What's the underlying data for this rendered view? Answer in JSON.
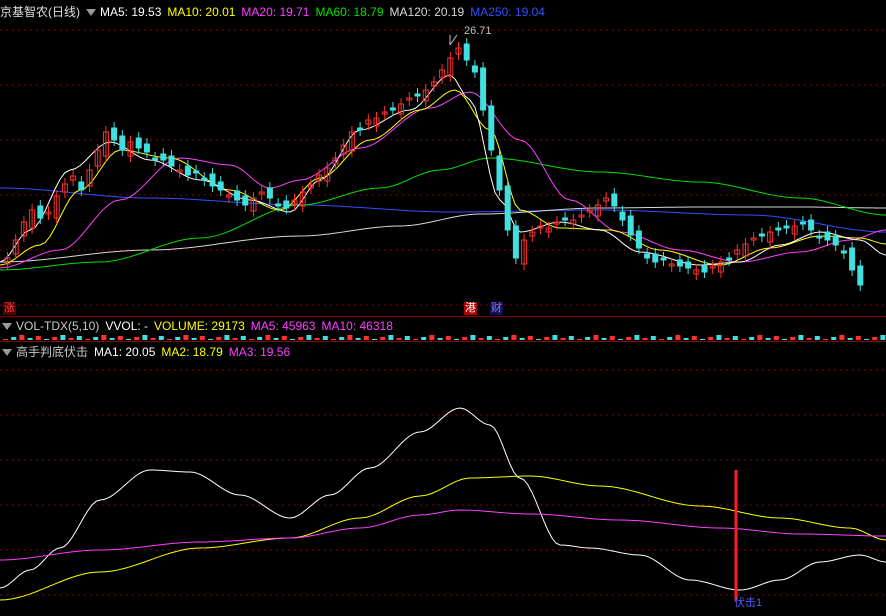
{
  "main": {
    "title": "京基智农(日线)",
    "ma": [
      {
        "label": "MA5: 19.53",
        "color": "#ffffff"
      },
      {
        "label": "MA10: 20.01",
        "color": "#ffff00"
      },
      {
        "label": "MA20: 19.71",
        "color": "#ff40ff"
      },
      {
        "label": "MA60: 18.79",
        "color": "#00e000"
      },
      {
        "label": "MA120: 20.19",
        "color": "#d8d8d8"
      },
      {
        "label": "MA250: 19.04",
        "color": "#3050ff"
      }
    ],
    "peak_label": "26.71",
    "tags": [
      {
        "text": "涨",
        "color": "#ff4040",
        "bg": "#500000"
      },
      {
        "text": "港",
        "color": "#ffffff",
        "bg": "#b00000"
      },
      {
        "text": "财",
        "color": "#8080ff",
        "bg": "#101050"
      }
    ]
  },
  "volume": {
    "title": "VOL-TDX(5,10)",
    "items": [
      {
        "label": "VVOL: -",
        "color": "#ffffff"
      },
      {
        "label": "VOLUME: 29173",
        "color": "#ffff00"
      },
      {
        "label": "MA5: 45963",
        "color": "#ff40ff"
      },
      {
        "label": "MA10: 46318",
        "color": "#ff40ff"
      }
    ]
  },
  "indicator": {
    "title": "高手判底伏击",
    "items": [
      {
        "label": "MA1: 20.05",
        "color": "#ffffff"
      },
      {
        "label": "MA2: 18.79",
        "color": "#ffff00"
      },
      {
        "label": "MA3: 19.56",
        "color": "#ff40ff"
      }
    ],
    "signal_label": "伏击1"
  },
  "colors": {
    "up": "#ff3030",
    "down": "#40e0e0",
    "grid": "#8b0000",
    "signal": "#ff2020"
  }
}
